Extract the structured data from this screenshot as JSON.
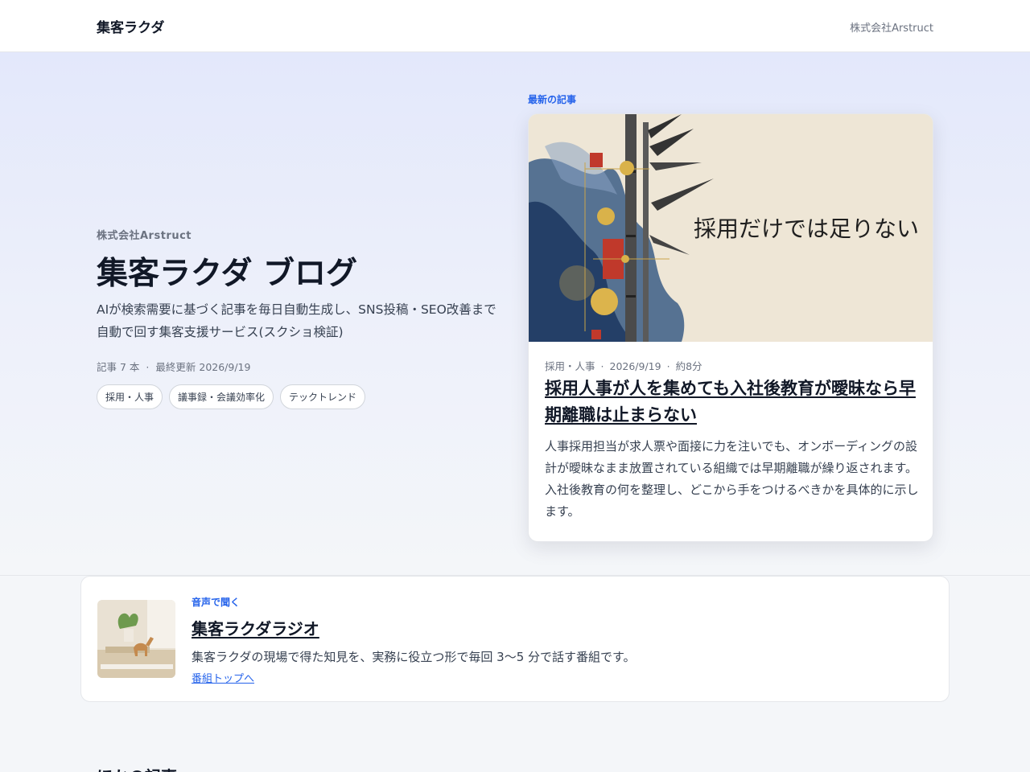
{
  "header": {
    "brand": "集客ラクダ",
    "company_link": "株式会社Arstruct"
  },
  "hero": {
    "eyebrow": "株式会社Arstruct",
    "title": "集客ラクダ ブログ",
    "description": "AIが検索需要に基づく記事を毎日自動生成し、SNS投稿・SEO改善まで自動で回す集客支援サービス(スクショ検証)",
    "article_count": "記事 7 本",
    "last_updated": "最終更新 2026/9/19",
    "tags": [
      "採用・人事",
      "議事録・会議効率化",
      "テックトレンド"
    ]
  },
  "latest": {
    "label": "最新の記事",
    "image_text": "採用だけでは足りない",
    "category": "採用・人事",
    "date": "2026/9/19",
    "read_time": "約8分",
    "title": "採用人事が人を集めても入社後教育が曖昧なら早期離職は止まらない",
    "excerpt": "人事採用担当が求人票や面接に力を注いでも、オンボーディングの設計が曖昧なまま放置されている組織では早期離職が繰り返されます。入社後教育の何を整理し、どこから手をつけるべきかを具体的に示します。"
  },
  "radio": {
    "eyebrow": "音声で聞く",
    "title": "集客ラクダラジオ",
    "description": "集客ラクダの現場で得た知見を、実務に役立つ形で毎回 3〜5 分で話す番組です。",
    "link": "番組トップへ"
  },
  "other": {
    "heading": "ほかの記事"
  },
  "colors": {
    "accent": "#2563eb",
    "text": "#111827",
    "muted": "#6b7280"
  }
}
